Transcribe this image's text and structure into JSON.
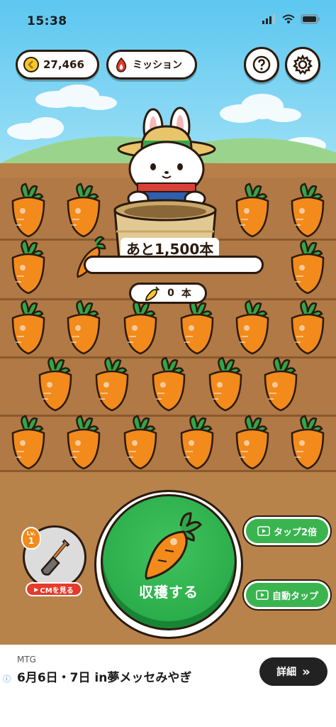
{
  "status": {
    "time": "15:38"
  },
  "top": {
    "coins": "27,466",
    "mission_label": "ミッション",
    "help_icon": "question-icon",
    "settings_icon": "gear-icon"
  },
  "progress": {
    "remaining_label": "あと1,500本",
    "fill_fraction": 0,
    "count_value": "0",
    "count_unit": "本"
  },
  "harvest": {
    "label": "収穫する"
  },
  "side": {
    "tap_double": "タップ2倍",
    "auto_tap": "自動タップ"
  },
  "shovel": {
    "level_prefix": "Lv.",
    "level": "1",
    "cm_label": "CMを見る"
  },
  "ad": {
    "brand": "MTG",
    "text": "6月6日・7日 in夢メッセみやぎ",
    "button": "詳細",
    "arrow": "»"
  },
  "colors": {
    "sky": "#5cc7f0",
    "soil": "#b07945",
    "carrot": "#f28a1c",
    "harvest_green": "#2bb24a"
  }
}
